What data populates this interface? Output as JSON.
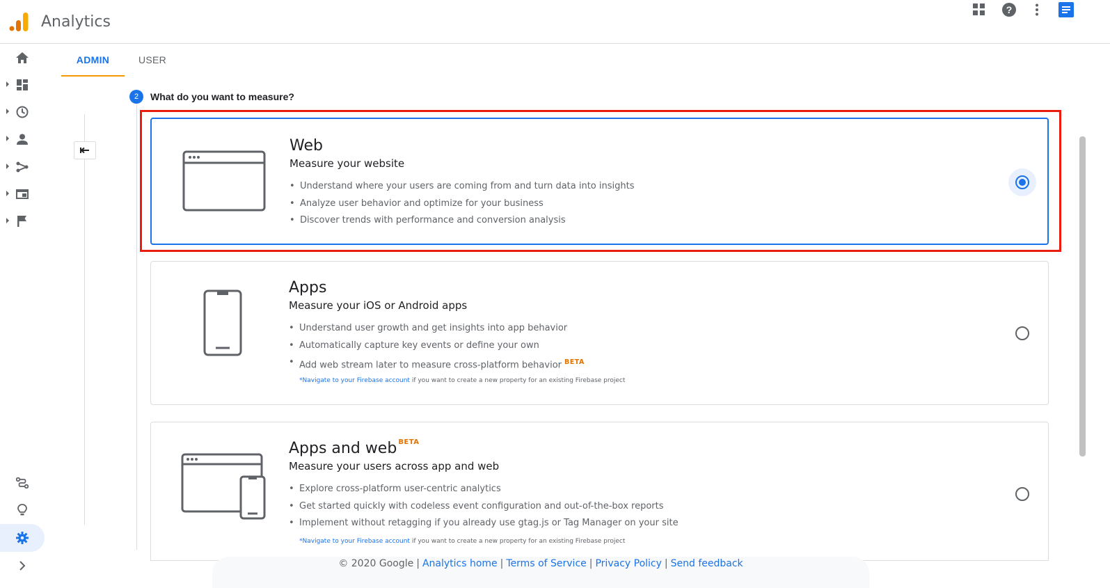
{
  "app": {
    "title": "Analytics"
  },
  "colors": {
    "accent": "#1a73e8",
    "tab_underline": "#f29900",
    "highlight": "#ea1c0d",
    "beta": "#e37400"
  },
  "header": {
    "icons": [
      "apps-grid-icon",
      "help-icon",
      "more-vert-icon",
      "account-icon"
    ]
  },
  "rail": {
    "items": [
      "home-icon",
      "customization-icon",
      "realtime-icon",
      "audience-icon",
      "acquisition-icon",
      "behavior-icon",
      "conversions-icon"
    ],
    "bottom": [
      "attribution-icon",
      "discover-icon",
      "admin-gear-icon",
      "expand-icon"
    ]
  },
  "tabs": [
    {
      "label": "ADMIN",
      "active": true
    },
    {
      "label": "USER",
      "active": false
    }
  ],
  "step": {
    "number": "2",
    "title": "What do you want to measure?"
  },
  "cards": {
    "web": {
      "title": "Web",
      "subtitle": "Measure your website",
      "bullets": [
        "Understand where your users are coming from and turn data into insights",
        "Analyze user behavior and optimize for your business",
        "Discover trends with performance and conversion analysis"
      ],
      "selected": true
    },
    "apps": {
      "title": "Apps",
      "subtitle": "Measure your iOS or Android apps",
      "bullets": [
        "Understand user growth and get insights into app behavior",
        "Automatically capture key events or define your own",
        "Add web stream later to measure cross-platform behavior"
      ],
      "beta": "BETA",
      "note_link": "*Navigate to your Firebase account",
      "note_text": " if you want to create a new property for an existing Firebase project",
      "selected": false
    },
    "apps_web": {
      "title": "Apps and web",
      "title_beta": "BETA",
      "subtitle": "Measure your users across app and web",
      "bullets": [
        "Explore cross-platform user-centric analytics",
        "Get started quickly with codeless event configuration and out-of-the-box reports",
        "Implement without retagging if you already use gtag.js or Tag Manager on your site"
      ],
      "note_link": "*Navigate to your Firebase account",
      "note_text": " if you want to create a new property for an existing Firebase project",
      "selected": false
    }
  },
  "footer": {
    "copyright": "© 2020 Google",
    "links": [
      "Analytics home",
      "Terms of Service",
      "Privacy Policy",
      "Send feedback"
    ],
    "separator": "|"
  }
}
